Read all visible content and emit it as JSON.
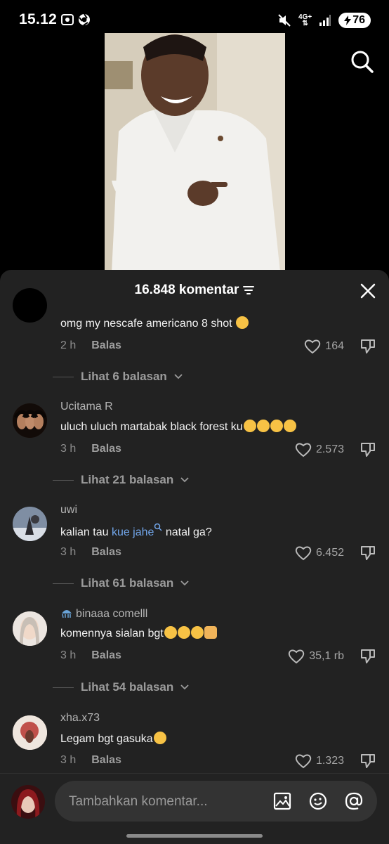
{
  "status_bar": {
    "time": "15.12",
    "network": "4G+",
    "battery": "76"
  },
  "sheet": {
    "comment_count": "16.848 komentar"
  },
  "comments": [
    {
      "username": "",
      "text": "omg my nescafe americano 8 shot",
      "time": "2 h",
      "reply": "Balas",
      "likes": "164",
      "view_replies": "Lihat 6 balasan"
    },
    {
      "username": "Ucitama R",
      "text": "uluch uluch martabak black forest ku",
      "time": "3 h",
      "reply": "Balas",
      "likes": "2.573",
      "view_replies": "Lihat 21 balasan"
    },
    {
      "username": "uwi",
      "text_before": "kalian tau ",
      "link": "kue jahe",
      "text_after": " natal ga?",
      "time": "3 h",
      "reply": "Balas",
      "likes": "6.452",
      "view_replies": "Lihat 61 balasan"
    },
    {
      "username": "binaaa comelll",
      "text": "komennya sialan bgt",
      "time": "3 h",
      "reply": "Balas",
      "likes": "35,1 rb",
      "view_replies": "Lihat 54 balasan"
    },
    {
      "username": "xha.x73",
      "text": "Legam bgt gasuka",
      "time": "3 h",
      "reply": "Balas",
      "likes": "1.323"
    }
  ],
  "input": {
    "placeholder": "Tambahkan komentar..."
  },
  "colors": {
    "sheet_bg": "#222222",
    "link": "#72a6ea",
    "input_bg": "#333333"
  }
}
